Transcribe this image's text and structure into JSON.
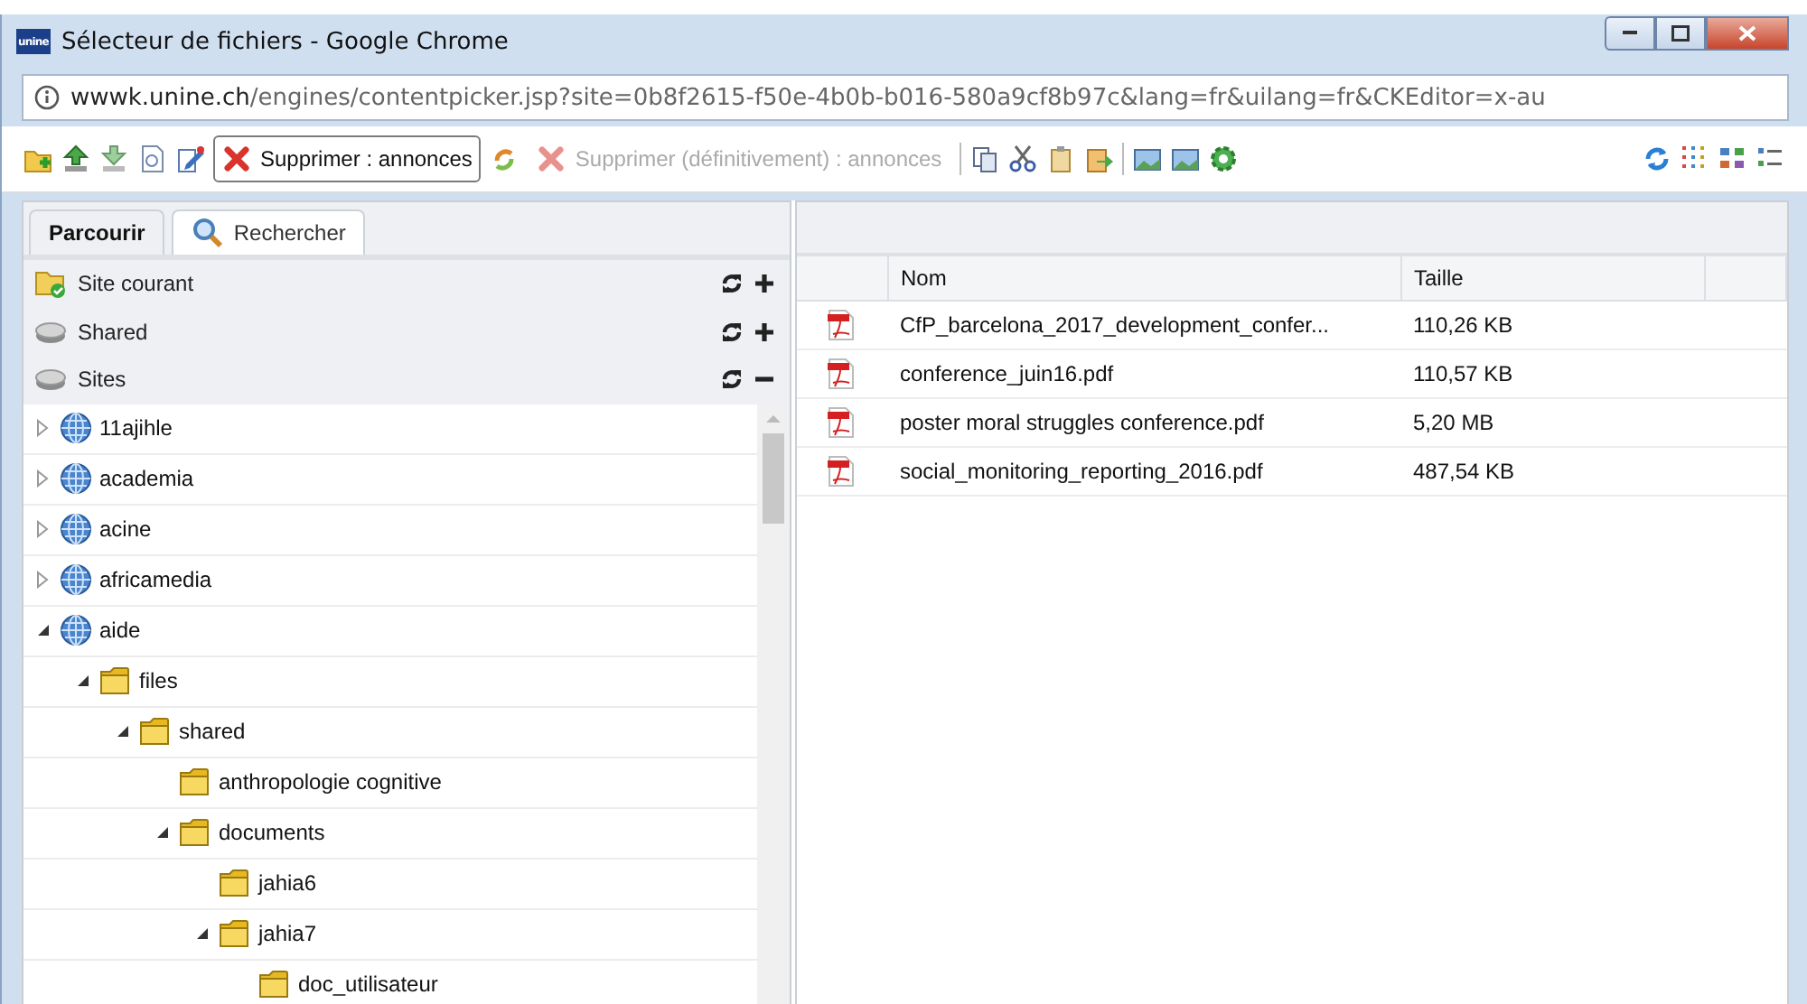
{
  "window": {
    "logo": "unine",
    "title": "Sélecteur de fichiers - Google Chrome"
  },
  "address_bar": {
    "host": "wwwk.unine.ch",
    "path": "/engines/contentpicker.jsp?site=0b8f2615-f50e-4b0b-b016-580a9cf8b97c&lang=fr&uilang=fr&CKEditor=x-au"
  },
  "toolbar": {
    "delete_button": {
      "label": "Supprimer : annonces",
      "disabled": false
    },
    "delete_permanent_button": {
      "label": "Supprimer (définitivement) : annonces",
      "disabled": true
    }
  },
  "tabs": [
    {
      "label": "Parcourir",
      "selected": true
    },
    {
      "label": "Rechercher",
      "selected": false
    }
  ],
  "sections": [
    {
      "label": "Site courant",
      "kind": "current-site",
      "expanded": false
    },
    {
      "label": "Shared",
      "kind": "drive",
      "expanded": false
    },
    {
      "label": "Sites",
      "kind": "drive",
      "expanded": true
    }
  ],
  "tree": [
    {
      "label": "11ajihle",
      "kind": "globe",
      "leaf": false,
      "expanded": false
    },
    {
      "label": "academia",
      "kind": "globe",
      "leaf": false,
      "expanded": false
    },
    {
      "label": "acine",
      "kind": "globe",
      "leaf": false,
      "expanded": false
    },
    {
      "label": "africamedia",
      "kind": "globe",
      "leaf": false,
      "expanded": false
    },
    {
      "label": "aide",
      "kind": "globe",
      "leaf": false,
      "expanded": true,
      "children": [
        {
          "label": "files",
          "kind": "folder",
          "leaf": false,
          "expanded": true,
          "children": [
            {
              "label": "shared",
              "kind": "folder",
              "leaf": false,
              "expanded": true,
              "children": [
                {
                  "label": "anthropologie cognitive",
                  "kind": "folder",
                  "leaf": true
                },
                {
                  "label": "documents",
                  "kind": "folder",
                  "leaf": false,
                  "expanded": true,
                  "children": [
                    {
                      "label": "jahia6",
                      "kind": "folder",
                      "leaf": true
                    },
                    {
                      "label": "jahia7",
                      "kind": "folder",
                      "leaf": false,
                      "expanded": true,
                      "children": [
                        {
                          "label": "doc_utilisateur",
                          "kind": "folder",
                          "leaf": true
                        }
                      ]
                    }
                  ]
                }
              ]
            }
          ]
        }
      ]
    }
  ],
  "table": {
    "columns": [
      "Nom",
      "Taille"
    ],
    "rows": [
      {
        "name": "CfP_barcelona_2017_development_confer...",
        "size": "110,26 KB"
      },
      {
        "name": "conference_juin16.pdf",
        "size": "110,57 KB"
      },
      {
        "name": "poster moral struggles conference.pdf",
        "size": "5,20 MB"
      },
      {
        "name": "social_monitoring_reporting_2016.pdf",
        "size": "487,54 KB"
      }
    ]
  }
}
